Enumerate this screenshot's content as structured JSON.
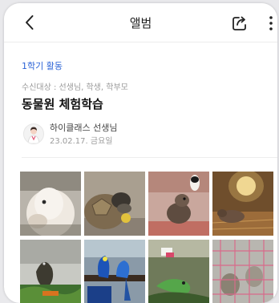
{
  "header": {
    "title": "앨범"
  },
  "post": {
    "category": "1학기 활동",
    "recipients": "수신대상 : 선생님, 학생, 학부모",
    "title": "동물원 체험학습",
    "author": "하이클래스 선생님",
    "date": "23.02.17. 금요일"
  },
  "photos": [
    {
      "subject": "alpaca"
    },
    {
      "subject": "tortoise"
    },
    {
      "subject": "otters"
    },
    {
      "subject": "capybara"
    },
    {
      "subject": "bird"
    },
    {
      "subject": "macaw"
    },
    {
      "subject": "chameleon"
    },
    {
      "subject": "rabbits"
    }
  ]
}
